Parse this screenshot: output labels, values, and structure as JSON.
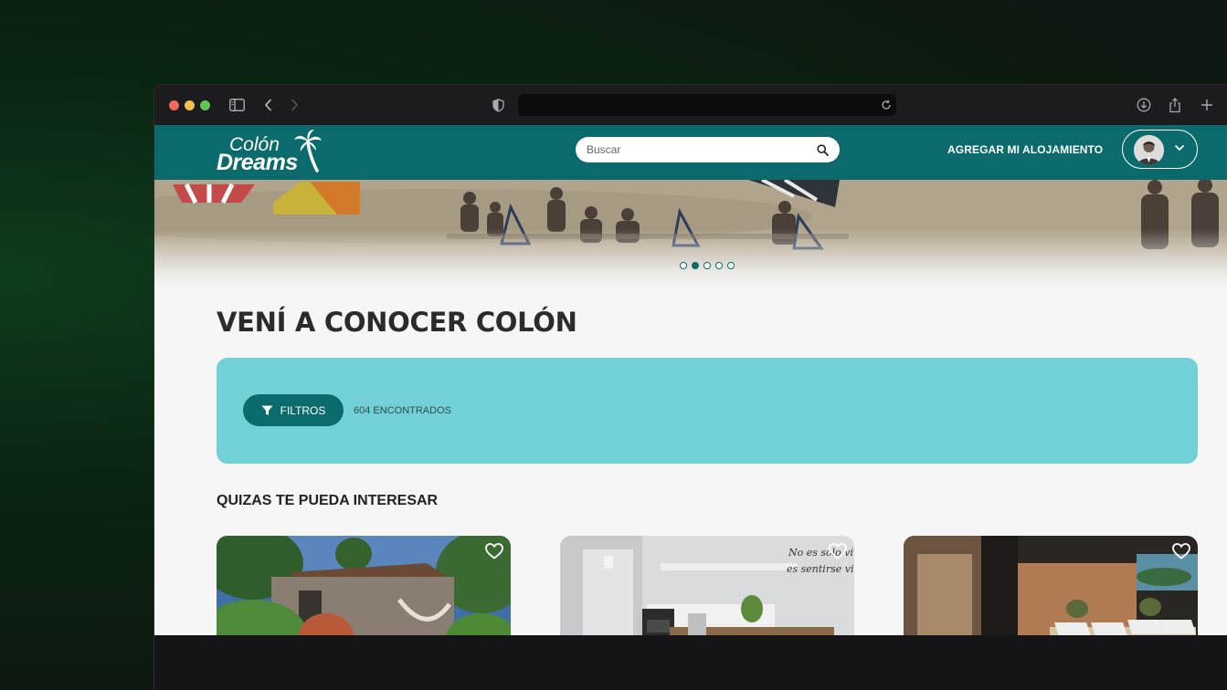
{
  "browser": {
    "sidebar_icon": "sidebar-icon",
    "back_icon": "chevron-left-icon",
    "forward_icon": "chevron-right-icon",
    "shield_icon": "shield-icon",
    "reload_icon": "reload-icon",
    "download_icon": "download-icon",
    "share_icon": "share-icon",
    "new_tab_icon": "plus-icon"
  },
  "header": {
    "logo_line1": "Colón",
    "logo_line2": "Dreams",
    "search_placeholder": "Buscar",
    "add_lodging": "AGREGAR MI ALOJAMIENTO",
    "brand_color": "#0b6a6b"
  },
  "carousel": {
    "slide_count": 5,
    "active_index": 1
  },
  "main": {
    "title": "VENÍ A CONOCER COLÓN",
    "filter_button": "FILTROS",
    "results_count": "604 ENCONTRADOS",
    "panel_color": "#72d0d7",
    "section_title": "QUIZAS TE PUEDA INTERESAR"
  }
}
